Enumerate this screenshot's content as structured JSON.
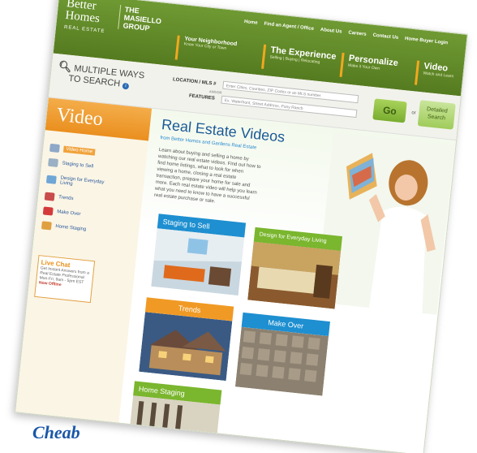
{
  "header": {
    "logo_line1": "Better",
    "logo_line2": "Homes",
    "logo_sub": "REAL ESTATE",
    "group_line1": "THE",
    "group_line2": "MASIELLO",
    "group_line3": "GROUP",
    "top_links": [
      "Home",
      "Find an Agent / Office",
      "About Us",
      "Careers",
      "Contact Us",
      "Home Buyer Login"
    ],
    "nav": [
      {
        "title": "Your Neighborhood",
        "sub": "Know Your City or Town"
      },
      {
        "title": "The Experience",
        "sub": "Selling | Buying | Relocating"
      },
      {
        "title": "Personalize",
        "sub": "Make it Your Own"
      },
      {
        "title": "Video",
        "sub": "Watch and Learn"
      }
    ]
  },
  "search": {
    "ways_line1": "MULTIPLE WAYS",
    "ways_line2": "TO SEARCH",
    "info_icon": "i",
    "location_label": "LOCATION / MLS #",
    "location_placeholder": "Enter Cities, Counties, ZIP Codes or an MLS number",
    "and_or": "AND/OR",
    "features_label": "FEATURES",
    "features_placeholder": "Ex. Waterfront, Street Address, Pony Ranch",
    "go_label": "Go",
    "or_label": "or",
    "detailed_line1": "Detailed",
    "detailed_line2": "Search"
  },
  "sidebar": {
    "title": "Video",
    "items": [
      {
        "label": "Video Home",
        "icon": "film-icon"
      },
      {
        "label": "Staging to Sell",
        "icon": "house-icon"
      },
      {
        "label": "Design for Everyday Living",
        "icon": "sofa-icon"
      },
      {
        "label": "Trends",
        "icon": "chart-icon"
      },
      {
        "label": "Make Over",
        "icon": "brush-icon"
      },
      {
        "label": "Home Staging",
        "icon": "lamp-icon"
      }
    ],
    "chat_title": "Live Chat",
    "chat_text": "Get Instant Answers from a Real Estate Professional Mon-Fri, 9am - 5pm EST",
    "chat_status": "Now Offline"
  },
  "main": {
    "title": "Real Estate Videos",
    "from": "from Better Homes and Gardens Real Estate",
    "intro": "Learn about buying and selling a home by watching our real estate videos. Find out how to find home listings, what to look for when viewing a home, closing a real estate transaction, prepare your home for sale and more. Each real estate video will help you learn what you need to know to have a successful real estate purchase or sale.",
    "tiles": [
      {
        "label": "Staging to Sell",
        "color": "#1e8fd0"
      },
      {
        "label": "Design for Everyday Living",
        "color": "#7ab62e"
      },
      {
        "label": "Trends",
        "color": "#f09a25"
      },
      {
        "label": "Make Over",
        "color": "#1e8fd0"
      },
      {
        "label": "Home Staging",
        "color": "#7ab62e"
      }
    ]
  },
  "footer": {
    "text": "Cheab"
  }
}
